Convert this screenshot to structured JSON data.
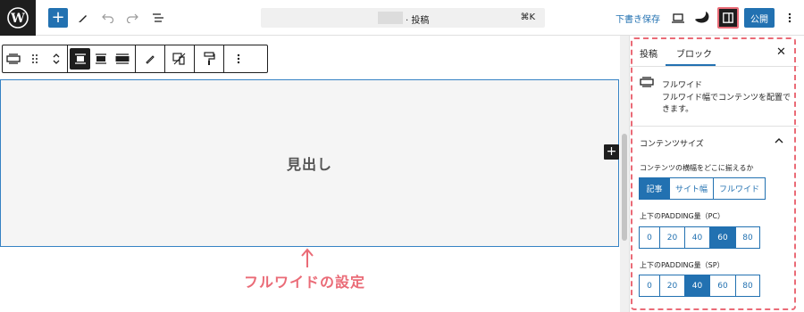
{
  "topbar": {
    "document_title": "· 投稿",
    "shortcut": "⌘K",
    "save_draft": "下書き保存",
    "publish": "公開"
  },
  "canvas": {
    "heading_placeholder": "見出し",
    "annotation": "フルワイドの設定"
  },
  "sidebar": {
    "tabs": [
      "投稿",
      "ブロック"
    ],
    "active_tab": "ブロック",
    "block_name": "フルワイド",
    "block_description": "フルワイド幅でコンテンツを配置できます。",
    "panel_title": "コンテンツサイズ",
    "align_label": "コンテンツの横幅をどこに揃えるか",
    "align_options": [
      "記事",
      "サイト幅",
      "フルワイド"
    ],
    "align_selected": "記事",
    "padding_pc_label": "上下のPADDING量（PC）",
    "padding_pc_options": [
      "0",
      "20",
      "40",
      "60",
      "80"
    ],
    "padding_pc_selected": "60",
    "padding_sp_label": "上下のPADDING量（SP）",
    "padding_sp_options": [
      "0",
      "20",
      "40",
      "60",
      "80"
    ],
    "padding_sp_selected": "40"
  },
  "colors": {
    "accent": "#2271b1",
    "annotation": "#ea6b77",
    "dark": "#1e1e1e"
  }
}
